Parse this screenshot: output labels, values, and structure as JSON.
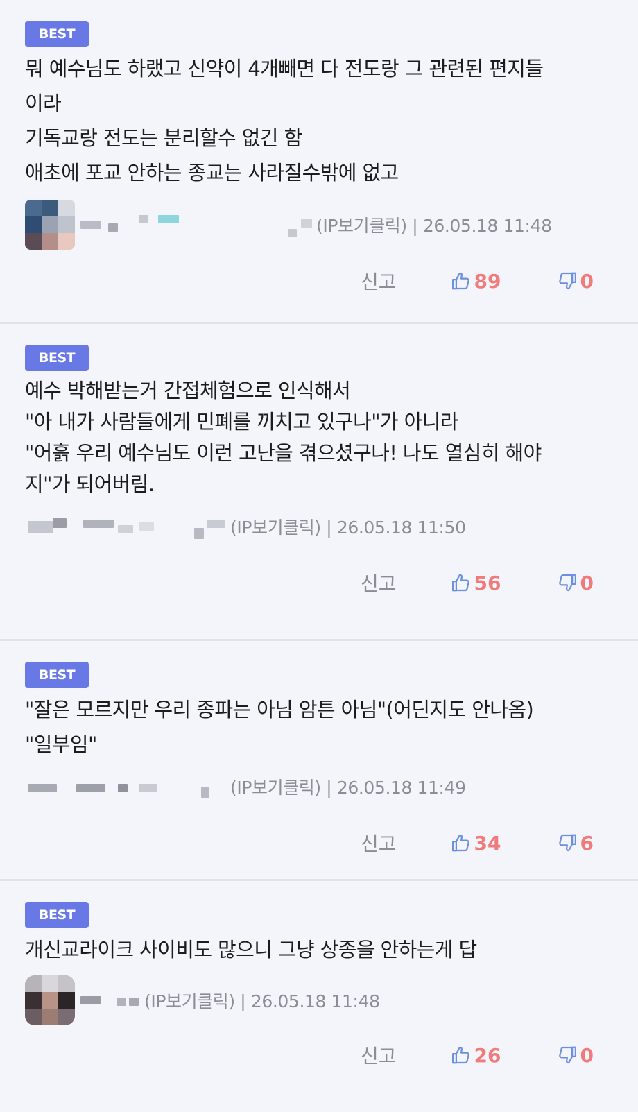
{
  "comments": [
    {
      "badge": "BEST",
      "lines": [
        "뭐 예수님도 하랬고 신약이 4개빼면 다 전도랑 그 관련된 편지들",
        "이라",
        "기독교랑 전도는 분리할수 없긴 함",
        "애초에 포교 안하는 종교는 사라질수밖에 없고"
      ],
      "meta": "(IP보기클릭) | 26.05.18 11:48",
      "report_label": "신고",
      "likes": "89",
      "dislikes": "0"
    },
    {
      "badge": "BEST",
      "lines": [
        "예수 박해받는거 간접체험으로 인식해서",
        "\"아 내가 사람들에게 민폐를 끼치고 있구나\"가 아니라",
        "\"어흙 우리 예수님도 이런 고난을 겪으셨구나! 나도 열심히 해야",
        "지\"가 되어버림."
      ],
      "meta": "(IP보기클릭) | 26.05.18 11:50",
      "report_label": "신고",
      "likes": "56",
      "dislikes": "0"
    },
    {
      "badge": "BEST",
      "lines": [
        "\"잘은 모르지만 우리 종파는 아님 암튼 아님\"(어딘지도 안나옴)",
        "\"일부임\""
      ],
      "meta": "(IP보기클릭) | 26.05.18 11:49",
      "report_label": "신고",
      "likes": "34",
      "dislikes": "6"
    },
    {
      "badge": "BEST",
      "lines": [
        "개신교라이크 사이비도 많으니 그냥 상종을 안하는게 답"
      ],
      "meta": "(IP보기클릭) | 26.05.18 11:48",
      "report_label": "신고",
      "likes": "26",
      "dislikes": "0"
    }
  ],
  "colors": {
    "background": "#f4f5fb",
    "badge": "#6879e6",
    "vote_count": "#ef7b7b",
    "vote_icon": "#6d8fe0",
    "meta_text": "#8a8d96"
  },
  "icons": {
    "like": "thumbs-up-icon",
    "dislike": "thumbs-down-icon"
  }
}
